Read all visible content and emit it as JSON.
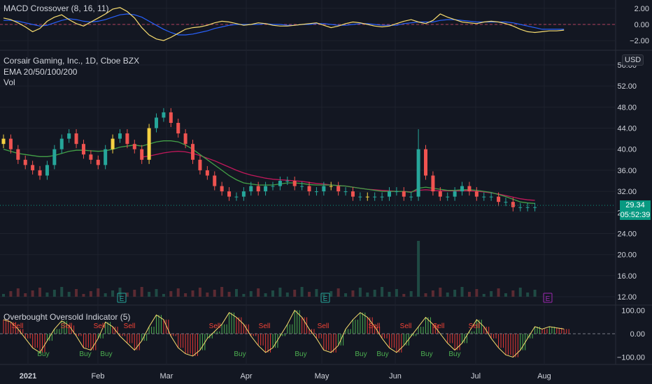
{
  "macd": {
    "title": "MACD Crossover (8, 16, 11)",
    "yticks": [
      "2.00",
      "0.00",
      "−2.00"
    ],
    "macd_line": [
      0.8,
      0.6,
      0.2,
      -0.3,
      -0.9,
      -0.5,
      0.4,
      0.9,
      1.2,
      0.6,
      0.1,
      -0.2,
      0.3,
      0.8,
      1.3,
      1.9,
      2.1,
      1.6,
      0.8,
      -0.4,
      -1.3,
      -1.8,
      -2.0,
      -1.6,
      -1.1,
      -0.6,
      -0.4,
      -0.3,
      -0.1,
      0.2,
      0.4,
      0.3,
      0.1,
      -0.1,
      0.0,
      0.2,
      0.1,
      -0.1,
      -0.2,
      -0.2,
      -0.1,
      0.0,
      0.1,
      0.2,
      -0.1,
      -0.4,
      -0.2,
      0.1,
      0.3,
      0.2,
      0.0,
      -0.2,
      -0.3,
      -0.2,
      0.1,
      0.4,
      0.6,
      0.3,
      0.1,
      0.5,
      1.3,
      0.9,
      0.6,
      0.3,
      0.2,
      0.1,
      0.3,
      0.4,
      0.3,
      0.1,
      -0.2,
      -0.6,
      -0.9,
      -1.0,
      -0.9,
      -0.8,
      -0.8,
      -0.7
    ],
    "signal_line": [
      0.5,
      0.5,
      0.4,
      0.2,
      0.0,
      -0.2,
      -0.1,
      0.2,
      0.5,
      0.7,
      0.6,
      0.4,
      0.3,
      0.4,
      0.6,
      0.9,
      1.2,
      1.3,
      1.2,
      0.9,
      0.4,
      -0.1,
      -0.6,
      -1.0,
      -1.3,
      -1.3,
      -1.2,
      -1.0,
      -0.8,
      -0.5,
      -0.3,
      -0.1,
      0.0,
      0.0,
      0.0,
      0.0,
      0.1,
      0.0,
      0.0,
      -0.1,
      -0.1,
      0.0,
      0.0,
      0.1,
      0.1,
      0.0,
      -0.1,
      -0.1,
      0.0,
      0.1,
      0.1,
      0.0,
      -0.1,
      -0.1,
      -0.1,
      0.1,
      0.2,
      0.3,
      0.3,
      0.3,
      0.5,
      0.6,
      0.6,
      0.5,
      0.4,
      0.3,
      0.3,
      0.3,
      0.3,
      0.3,
      0.2,
      0.0,
      -0.2,
      -0.4,
      -0.6,
      -0.6,
      -0.6,
      -0.6
    ]
  },
  "main": {
    "title": "Corsair Gaming, Inc., 1D, Cboe BZX",
    "ema_label": "EMA 20/50/100/200",
    "vol_label": "Vol",
    "currency": "USD",
    "yticks": [
      "56.00",
      "52.00",
      "48.00",
      "44.00",
      "40.00",
      "36.00",
      "32.00",
      "28.00",
      "24.00",
      "20.00",
      "16.00",
      "12.00"
    ],
    "last_price": "29.34",
    "countdown": "05:52:39",
    "earnings_marker": "E"
  },
  "osc": {
    "title": "Overbought Oversold Indicator (5)",
    "yticks": [
      "100.00",
      "0.00",
      "−100.00"
    ],
    "values": [
      60,
      50,
      20,
      -20,
      -60,
      -80,
      -30,
      20,
      55,
      35,
      -10,
      -60,
      -70,
      -20,
      50,
      30,
      -10,
      -40,
      -70,
      -30,
      30,
      80,
      60,
      -10,
      -60,
      -85,
      -95,
      -70,
      -20,
      10,
      40,
      90,
      70,
      40,
      -10,
      -50,
      -80,
      -60,
      -10,
      40,
      100,
      70,
      20,
      -20,
      -70,
      -80,
      -50,
      20,
      60,
      90,
      70,
      30,
      -20,
      -60,
      -80,
      -50,
      -10,
      30,
      70,
      40,
      0,
      -40,
      -70,
      -40,
      10,
      60,
      30,
      -20,
      -60,
      -90,
      -100,
      -70,
      -20,
      30,
      20,
      30,
      25,
      20
    ],
    "sell_label": "Sell",
    "buy_label": "Buy"
  },
  "xaxis": {
    "labels": [
      "2021",
      "Feb",
      "Mar",
      "Apr",
      "May",
      "Jun",
      "Jul",
      "Aug"
    ]
  },
  "chart_data": {
    "type": "candlestick",
    "title": "Corsair Gaming, Inc., 1D, Cboe BZX",
    "ylim": [
      10,
      58
    ],
    "last": 29.34,
    "closes": [
      42,
      40,
      38,
      37,
      36,
      35,
      37,
      40,
      42,
      43,
      41,
      39,
      38,
      37,
      40,
      42,
      43,
      41,
      40,
      38,
      44,
      46,
      47,
      45,
      43,
      41,
      38,
      36,
      35,
      33,
      32,
      31,
      31,
      32,
      33,
      32,
      33,
      33,
      34,
      34,
      33,
      33,
      32,
      32,
      33,
      33,
      32,
      32,
      31,
      31,
      31,
      31,
      31,
      32,
      32,
      31,
      31,
      40,
      35,
      32,
      31,
      31,
      32,
      33,
      32,
      31,
      31,
      31,
      30,
      30,
      29,
      29,
      29,
      29
    ],
    "ema20": [
      40,
      39.6,
      39.2,
      39,
      38.8,
      38.6,
      38.6,
      38.8,
      39.2,
      39.6,
      39.8,
      39.8,
      39.7,
      39.6,
      39.7,
      40,
      40.4,
      40.6,
      40.8,
      40.6,
      41,
      41.4,
      41.6,
      41.6,
      41.4,
      40.8,
      40,
      39,
      38,
      37,
      36,
      35,
      34.2,
      33.6,
      33.4,
      33.2,
      33.2,
      33.2,
      33.4,
      33.6,
      33.6,
      33.5,
      33.3,
      33.2,
      33.2,
      33.2,
      33.1,
      33,
      32.8,
      32.6,
      32.4,
      32.2,
      32,
      32,
      32,
      32,
      31.8,
      32.6,
      32.8,
      32.6,
      32.4,
      32.2,
      32.2,
      32.3,
      32.3,
      32.2,
      32,
      31.8,
      31.4,
      31,
      30.5,
      30,
      29.8,
      29.7
    ],
    "ema50": [
      null,
      null,
      null,
      null,
      null,
      null,
      null,
      null,
      null,
      null,
      null,
      null,
      null,
      null,
      null,
      null,
      null,
      null,
      null,
      38.5,
      38.7,
      39,
      39.3,
      39.5,
      39.6,
      39.5,
      39.2,
      38.8,
      38.3,
      37.8,
      37.2,
      36.6,
      36,
      35.5,
      35.1,
      34.8,
      34.5,
      34.3,
      34.2,
      34.1,
      34,
      33.9,
      33.7,
      33.5,
      33.4,
      33.2,
      33.1,
      33,
      32.8,
      32.6,
      32.4,
      32.3,
      32.2,
      32.1,
      32,
      32,
      31.9,
      32.2,
      32.3,
      32.2,
      32.1,
      32.1,
      32.1,
      32.1,
      32.1,
      32,
      31.9,
      31.7,
      31.5,
      31.2,
      30.9,
      30.6,
      30.4,
      30.3
    ]
  }
}
